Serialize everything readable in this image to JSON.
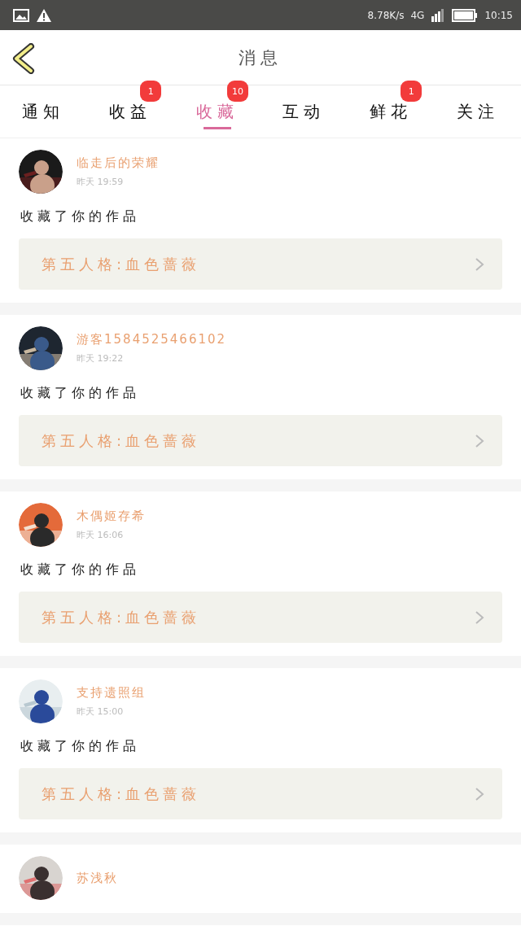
{
  "status_bar": {
    "speed": "8.78K/s",
    "network": "4G",
    "time": "10:15"
  },
  "header": {
    "title": "消息"
  },
  "tabs": [
    {
      "label": "通知",
      "selected": false
    },
    {
      "label": "收益",
      "selected": false,
      "badge": "1"
    },
    {
      "label": "收藏",
      "selected": true,
      "badge": "10"
    },
    {
      "label": "互动",
      "selected": false
    },
    {
      "label": "鲜花",
      "selected": false,
      "badge": "1"
    },
    {
      "label": "关注",
      "selected": false
    }
  ],
  "messages": [
    {
      "name": "临走后的荣耀",
      "time": "昨天 19:59",
      "text": "收藏了你的作品",
      "work": "第五人格:血色蔷薇"
    },
    {
      "name": "游客1584525466102",
      "time": "昨天 19:22",
      "text": "收藏了你的作品",
      "work": "第五人格:血色蔷薇"
    },
    {
      "name": "木偶姬存希",
      "time": "昨天 16:06",
      "text": "收藏了你的作品",
      "work": "第五人格:血色蔷薇"
    },
    {
      "name": "支持遗照组",
      "time": "昨天 15:00",
      "text": "收藏了你的作品",
      "work": "第五人格:血色蔷薇"
    },
    {
      "name": "苏浅秋"
    }
  ]
}
